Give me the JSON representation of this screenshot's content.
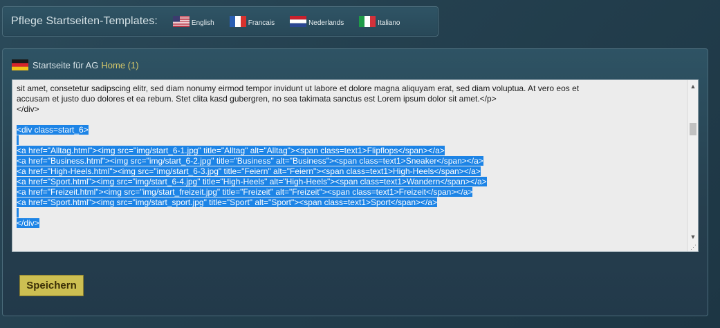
{
  "lang_bar": {
    "title": "Pflege Startseiten-Templates:",
    "languages": [
      {
        "label": "English",
        "icon": "flag-uk-icon"
      },
      {
        "label": "Francais",
        "icon": "flag-fr-icon"
      },
      {
        "label": "Nederlands",
        "icon": "flag-nl-icon"
      },
      {
        "label": "Italiano",
        "icon": "flag-it-icon"
      }
    ]
  },
  "panel": {
    "title": "Startseite für AG",
    "link": "Home (1)",
    "flag_icon": "flag-de-icon"
  },
  "editor": {
    "lines": [
      "sit amet, consetetur sadipscing elitr, sed diam nonumy eirmod tempor invidunt ut labore et dolore magna aliquyam erat, sed diam voluptua. At vero eos et",
      "accusam et justo duo dolores et ea rebum. Stet clita kasd gubergren, no sea takimata sanctus est Lorem ipsum dolor sit amet.</p>",
      "</div>",
      "",
      "<div class=start_6>",
      "",
      "<a href=\"Alltag.html\"><img src=\"img/start_6-1.jpg\" title=\"Alltag\" alt=\"Alltag\"><span class=text1>Flipflops</span></a>",
      "<a href=\"Business.html\"><img src=\"img/start_6-2.jpg\" title=\"Business\" alt=\"Business\"><span class=text1>Sneaker</span></a>",
      "<a href=\"High-Heels.html\"><img src=\"img/start_6-3.jpg\" title=\"Feiern\" alt=\"Feiern\"><span class=text1>High-Heels</span></a>",
      "<a href=\"Sport.html\"><img src=\"img/start_6-4.jpg\" title=\"High-Heels\" alt=\"High-Heels\"><span class=text1>Wandern</span></a>",
      "<a href=\"Freizeit.html\"><img src=\"img/start_freizeit.jpg\" title=\"Freizeit\" alt=\"Freizeit\"><span class=text1>Freizeit</span></a>",
      "<a href=\"Sport.html\"><img src=\"img/start_sport.jpg\" title=\"Sport\" alt=\"Sport\"><span class=text1>Sport</span></a>",
      "",
      "</div>"
    ],
    "selection_start_line": 4,
    "selection_end_line": 13,
    "selection_color": "#1d84e6"
  },
  "save_button": {
    "label": "Speichern",
    "color": "#cdbf52"
  },
  "colors": {
    "background": "#24404f",
    "link": "#d7c96a"
  }
}
